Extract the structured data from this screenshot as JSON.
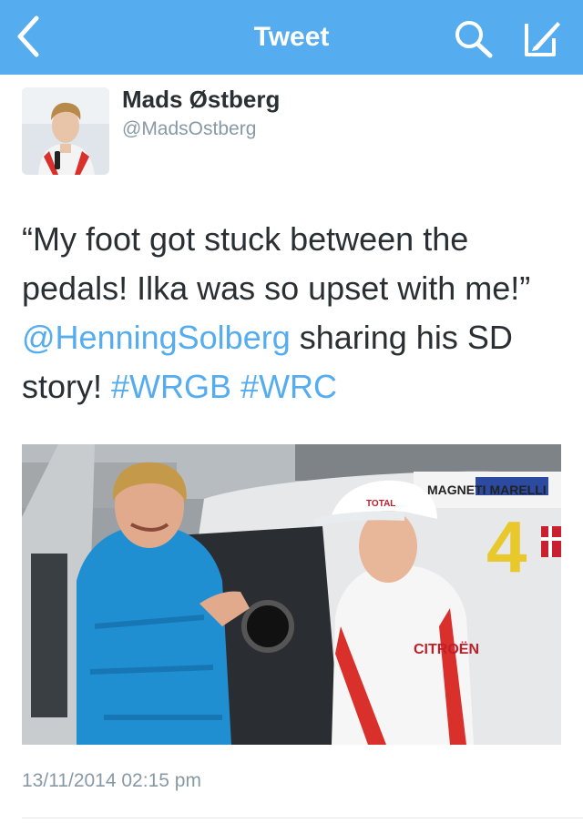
{
  "navbar": {
    "title": "Tweet",
    "back_icon": "chevron-left-icon",
    "search_icon": "search-icon",
    "compose_icon": "compose-icon",
    "background": "#55acee"
  },
  "tweet": {
    "author_name": "Mads Østberg",
    "author_handle": "@MadsOstberg",
    "text_part1": "“My foot got stuck between the pedals! Ilka was so upset with me!” ",
    "mention": "@HenningSolberg",
    "text_part2": " sharing his SD story! ",
    "hashtag1": "#WRGB",
    "hashtag2": "#WRC",
    "timestamp": "13/11/2014 02:15 pm",
    "link_color": "#55acee"
  },
  "photo": {
    "brand_text": "CITROËN",
    "car_number": "4",
    "sponsor_text": "MAGNETI MARELLI",
    "cap_text": "TOTAL"
  }
}
